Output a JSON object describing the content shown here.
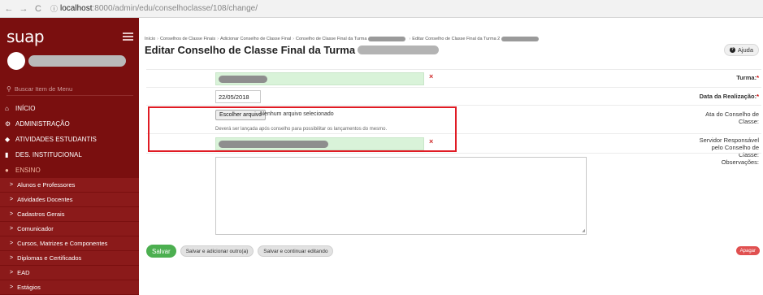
{
  "browser": {
    "url_host": "localhost",
    "url_path": ":8000/admin/edu/conselhoclasse/108/change/",
    "nav": [
      "←",
      "→",
      "C"
    ]
  },
  "sidebar": {
    "logo": "suap",
    "search_placeholder": "Buscar Item de Menu",
    "menu": [
      {
        "icon": "home-icon",
        "glyph": "⌂",
        "label": "INÍCIO"
      },
      {
        "icon": "admin-icon",
        "glyph": "⚙",
        "label": "ADMINISTRAÇÃO"
      },
      {
        "icon": "student-activities-icon",
        "glyph": "◆",
        "label": "ATIVIDADES ESTUDANTIS"
      },
      {
        "icon": "bar-chart-icon",
        "glyph": "▮",
        "label": "DES. INSTITUCIONAL"
      },
      {
        "icon": "ensino-icon",
        "glyph": "●",
        "label": "ENSINO"
      }
    ],
    "submenu": [
      "Alunos e Professores",
      "Atividades Docentes",
      "Cadastros Gerais",
      "Comunicador",
      "Cursos, Matrizes e Componentes",
      "Diplomas e Certificados",
      "EAD",
      "Estágios"
    ]
  },
  "main": {
    "breadcrumb": [
      "Início",
      "Conselhos de Classe Finais",
      "Adicionar Conselho de Classe Final",
      "Conselho de Classe Final da Turma",
      "Editar Conselho de Classe Final da Turma 2"
    ],
    "title": "Editar Conselho de Classe Final da Turma",
    "help_label": "Ajuda",
    "fields": {
      "turma_label": "Turma:",
      "data_label": "Data da Realização:",
      "data_value": "22/05/2018",
      "ata_label": "Ata do Conselho de Classe:",
      "file_button": "Escolher arquivo",
      "file_status": "Nenhum arquivo selecionado",
      "ata_help": "Deverá ser lançada após conselho para possibilitar os lançamentos do mesmo.",
      "servidor_label": "Servidor Responsável pelo Conselho de Classe:",
      "observacoes_label": "Observações:",
      "error_mark": "×",
      "required_mark": "*"
    },
    "actions": {
      "save": "Salvar",
      "save_add": "Salvar e adicionar outro(a)",
      "save_continue": "Salvar e continuar editando",
      "delete": "Apagar"
    }
  },
  "colors": {
    "sidebar_bg": "#7a0f0f",
    "valid_input_bg": "#d9f3d9",
    "highlight_border": "#e01b24",
    "save_green": "#4caf50",
    "delete_red": "#e05050"
  }
}
